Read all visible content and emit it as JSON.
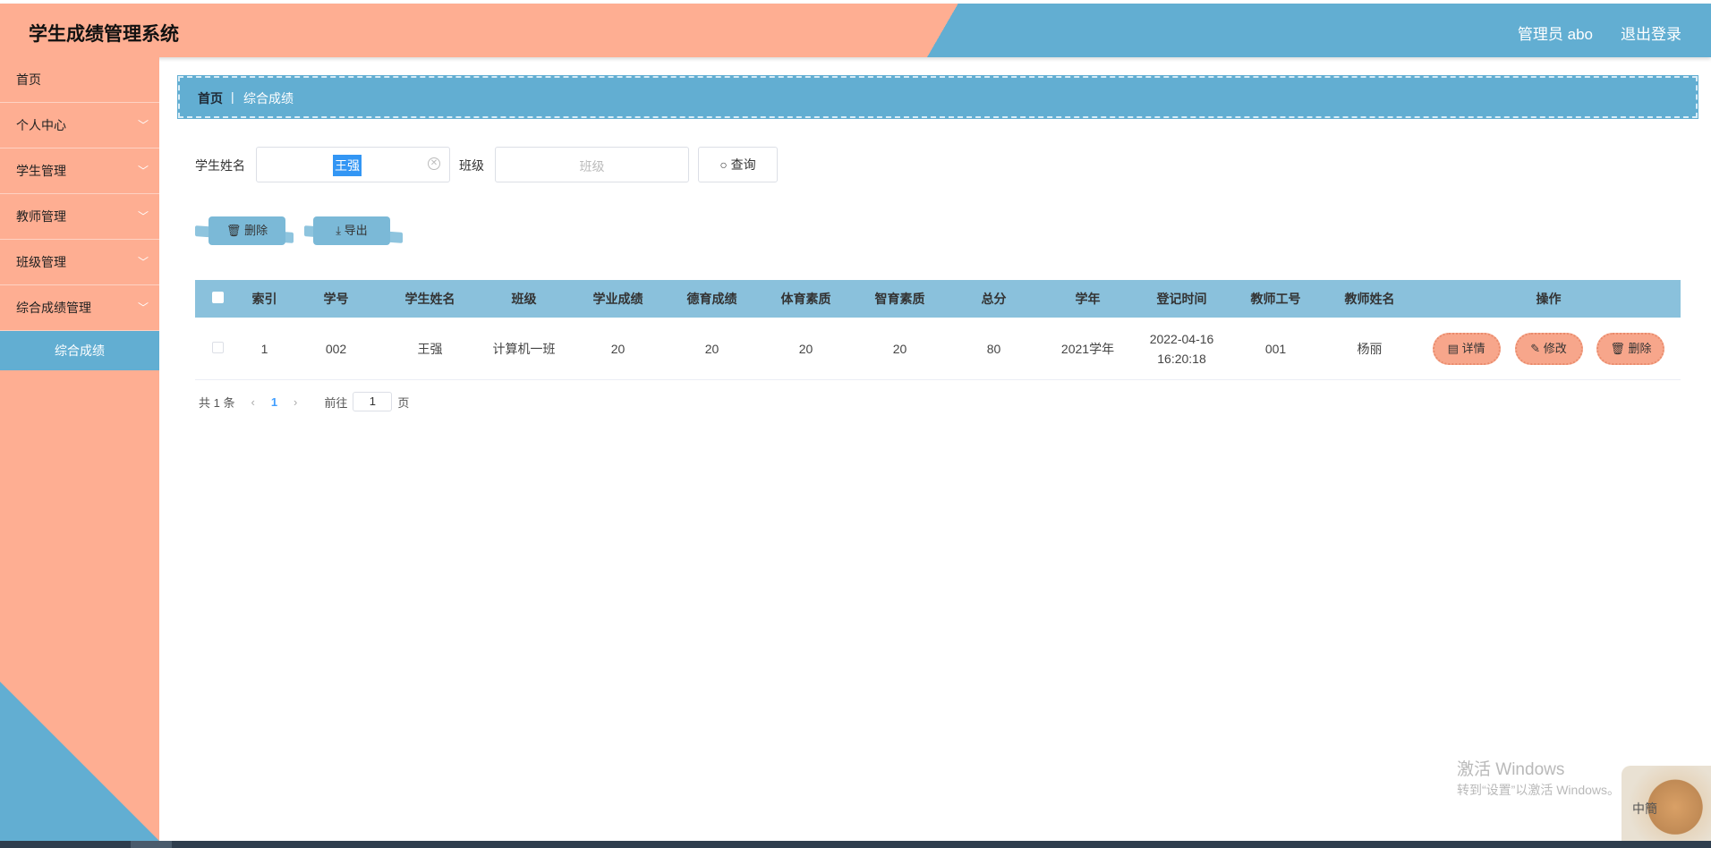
{
  "header": {
    "title": "学生成绩管理系统",
    "user": "管理员 abo",
    "logout": "退出登录"
  },
  "sidebar": {
    "items": [
      {
        "label": "首页",
        "chevron": ""
      },
      {
        "label": "个人中心",
        "chevron": "﹀"
      },
      {
        "label": "学生管理",
        "chevron": "﹀"
      },
      {
        "label": "教师管理",
        "chevron": "﹀"
      },
      {
        "label": "班级管理",
        "chevron": "﹀"
      },
      {
        "label": "综合成绩管理",
        "chevron": "﹀"
      }
    ],
    "active_sub": "综合成绩"
  },
  "breadcrumb": {
    "home": "首页",
    "separator": "|",
    "current": "综合成绩"
  },
  "search": {
    "name_label": "学生姓名",
    "name_value": "王强",
    "class_label": "班级",
    "class_placeholder": "班级",
    "query_button": "查询"
  },
  "actions": {
    "delete": "删除",
    "export": "导出"
  },
  "table": {
    "columns": [
      "索引",
      "学号",
      "学生姓名",
      "班级",
      "学业成绩",
      "德育成绩",
      "体育素质",
      "智育素质",
      "总分",
      "学年",
      "登记时间",
      "教师工号",
      "教师姓名",
      "操作"
    ],
    "rows": [
      {
        "index": "1",
        "student_no": "002",
        "name": "王强",
        "class": "计算机一班",
        "academic": "20",
        "moral": "20",
        "sports": "20",
        "intellect": "20",
        "total": "80",
        "year": "2021学年",
        "reg_date": "2022-04-16",
        "reg_time": "16:20:18",
        "teacher_no": "001",
        "teacher_name": "杨丽",
        "ops": {
          "detail": "详情",
          "edit": "修改",
          "delete": "删除"
        }
      }
    ]
  },
  "pager": {
    "total": "共 1 条",
    "prev": "‹",
    "current": "1",
    "next": "›",
    "goto": "前往",
    "goto_value": "1",
    "page": "页"
  },
  "watermark": {
    "line1": "激活 Windows",
    "line2": "转到“设置”以激活 Windows。",
    "badge": "中簡"
  },
  "colors": {
    "peach": "#feae92",
    "blue": "#62aed2",
    "header_table": "#8ac1dc"
  }
}
